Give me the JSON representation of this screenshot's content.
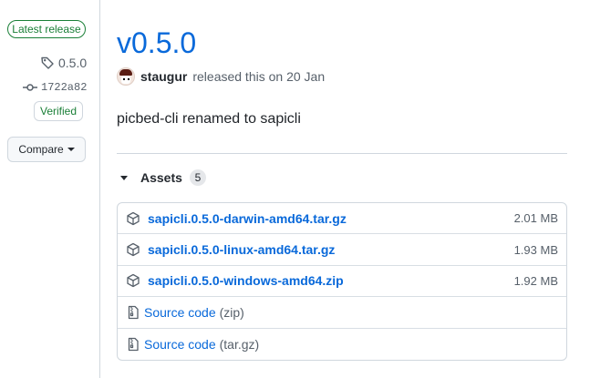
{
  "sidebar": {
    "latest_label": "Latest release",
    "tag": "0.5.0",
    "commit": "1722a82",
    "verified_label": "Verified",
    "compare_label": "Compare"
  },
  "release": {
    "title": "v0.5.0",
    "author": "staugur",
    "released_text": "released this on 20 Jan",
    "body": "picbed-cli renamed to sapicli"
  },
  "assets": {
    "heading": "Assets",
    "count": "5",
    "files": [
      {
        "name": "sapicli.0.5.0-darwin-amd64.tar.gz",
        "size": "2.01 MB",
        "icon": "package-icon"
      },
      {
        "name": "sapicli.0.5.0-linux-amd64.tar.gz",
        "size": "1.93 MB",
        "icon": "package-icon"
      },
      {
        "name": "sapicli.0.5.0-windows-amd64.zip",
        "size": "1.92 MB",
        "icon": "package-icon"
      }
    ],
    "sources": [
      {
        "label": "Source code",
        "kind": "(zip)",
        "icon": "file-zip-icon"
      },
      {
        "label": "Source code",
        "kind": "(tar.gz)",
        "icon": "file-zip-icon"
      }
    ]
  },
  "colors": {
    "link": "#0969da",
    "success": "#1a7f37",
    "muted": "#57606a",
    "border": "#d0d7de"
  }
}
